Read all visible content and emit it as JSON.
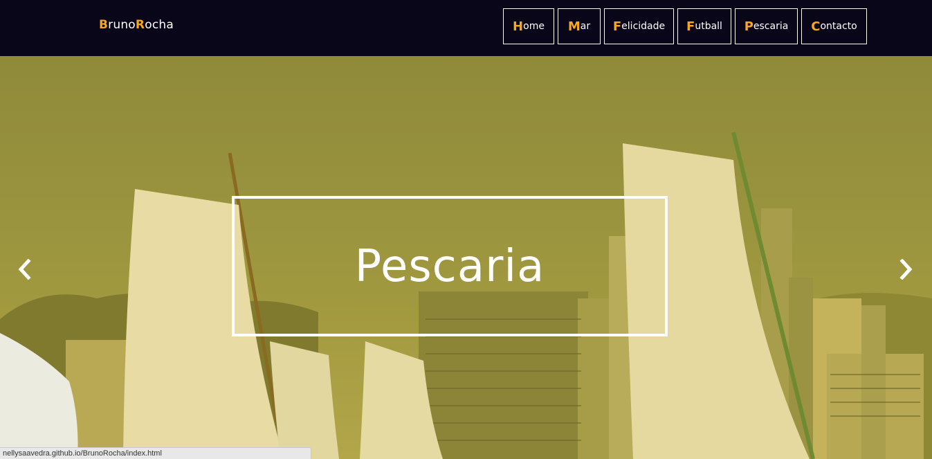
{
  "brand": {
    "first_letter": "B",
    "part1": "runo",
    "second_letter": "R",
    "part2": "ocha"
  },
  "nav": {
    "items": [
      {
        "first": "H",
        "rest": "ome"
      },
      {
        "first": "M",
        "rest": "ar"
      },
      {
        "first": "F",
        "rest": "elicidade"
      },
      {
        "first": "F",
        "rest": "utball"
      },
      {
        "first": "P",
        "rest": "escaria"
      },
      {
        "first": "C",
        "rest": "ontacto"
      }
    ]
  },
  "hero": {
    "caption": "Pescaria",
    "prev_icon": "chevron-left-icon",
    "next_icon": "chevron-right-icon"
  },
  "status_url": "nellysaavedra.github.io/BrunoRocha/index.html",
  "colors": {
    "navbar": "#090619",
    "accent": "#f5a623",
    "overlay": "#a59a3a"
  }
}
